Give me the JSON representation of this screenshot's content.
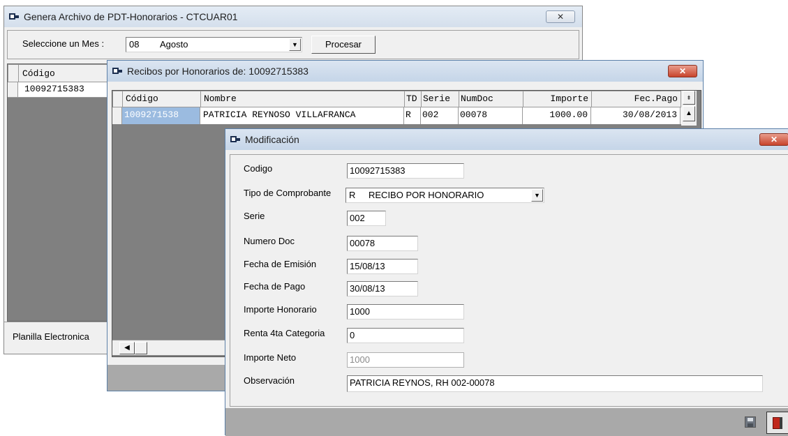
{
  "win1": {
    "title": "Genera Archivo de PDT-Honorarios - CTCUAR01",
    "close": "✕",
    "month_label": "Seleccione un Mes :",
    "month_code": "08",
    "month_name": "Agosto",
    "process_btn": "Procesar",
    "grid_header": "Código",
    "grid_row": "10092715383",
    "footer_btn": "Planilla Electronica"
  },
  "win2": {
    "title": "Recibos por Honorarios de: 10092715383",
    "close": "✕",
    "columns": [
      "Código",
      "Nombre",
      "TD",
      "Serie",
      "NumDoc",
      "Importe",
      "Fec.Pago"
    ],
    "row": {
      "codigo": "1009271538",
      "nombre": "PATRICIA REYNOSO VILLAFRANCA",
      "td": "R",
      "serie": "002",
      "numdoc": "00078",
      "importe": "1000.00",
      "fecpago": "30/08/2013"
    }
  },
  "win3": {
    "title": "Modificación",
    "close": "✕",
    "labels": {
      "codigo": "Codigo",
      "tipo": "Tipo de Comprobante",
      "serie": "Serie",
      "numero": "Numero Doc",
      "fecha_emision": "Fecha de Emisión",
      "fecha_pago": "Fecha de Pago",
      "importe": "Importe Honorario",
      "renta": "Renta 4ta Categoria",
      "neto": "Importe Neto",
      "obs": "Observación"
    },
    "values": {
      "codigo": "10092715383",
      "tipo_code": "R",
      "tipo_name": "RECIBO POR HONORARIO",
      "serie": "002",
      "numero": "00078",
      "fecha_emision": "15/08/13",
      "fecha_pago": "30/08/13",
      "importe": "1000",
      "renta": "0",
      "neto": "1000",
      "obs": "PATRICIA REYNOS, RH 002-00078"
    }
  }
}
